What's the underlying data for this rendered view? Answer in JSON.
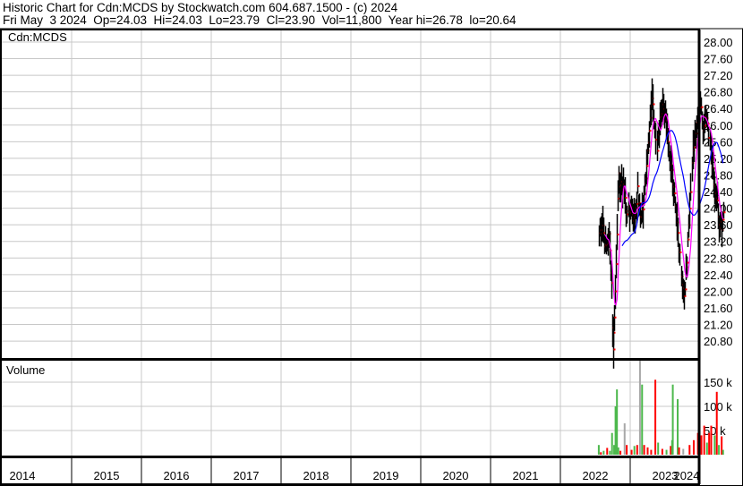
{
  "header": {
    "title": "Historic Chart for Cdn:MCDS by Stockwatch.com 604.687.1500 - (c) 2024",
    "quote": "Fri May  3 2024  Op=24.03  Hi=24.03  Lo=23.79  Cl=23.90  Vol=11,800  Year hi=26.78  lo=20.64"
  },
  "chart_data": {
    "type": "line",
    "symbol_label": "Cdn:MCDS",
    "volume_label": "Volume",
    "price_ticks": [
      "28.00",
      "27.60",
      "27.20",
      "26.80",
      "26.40",
      "26.00",
      "25.60",
      "25.20",
      "24.80",
      "24.40",
      "24.00",
      "23.60",
      "23.20",
      "22.80",
      "22.40",
      "22.00",
      "21.60",
      "21.20",
      "20.80"
    ],
    "ylim": [
      20.5,
      28.3
    ],
    "volume_ticks": [
      {
        "v": 150,
        "label": "150 k"
      },
      {
        "v": 100,
        "label": "100 k"
      },
      {
        "v": 50,
        "label": "50 k"
      }
    ],
    "years": [
      "2014",
      "2015",
      "2016",
      "2017",
      "2018",
      "2019",
      "2020",
      "2021",
      "2022",
      "2023",
      "2024"
    ],
    "xlim": [
      2014.0,
      2024.35
    ],
    "colors": {
      "price": "#000000",
      "close_dot": "#ff0000",
      "ma_short": "#ff00ff",
      "ma_long": "#0000ff",
      "vol_up": "#4cb84c",
      "vol_down": "#ff0000",
      "vol_flat": "#a8a8a8",
      "grid": "#c8c8c8"
    },
    "price_series": [
      [
        2022.55,
        23.4
      ],
      [
        2022.6,
        23.6
      ],
      [
        2022.64,
        23.0
      ],
      [
        2022.69,
        23.3
      ],
      [
        2022.73,
        22.2
      ],
      [
        2022.74,
        21.2
      ],
      [
        2022.76,
        20.7
      ],
      [
        2022.78,
        22.0
      ],
      [
        2022.81,
        23.5
      ],
      [
        2022.83,
        24.7
      ],
      [
        2022.87,
        24.5
      ],
      [
        2022.9,
        24.6
      ],
      [
        2022.94,
        24.0
      ],
      [
        2022.97,
        23.9
      ],
      [
        2023.01,
        24.0
      ],
      [
        2023.05,
        23.7
      ],
      [
        2023.1,
        24.4
      ],
      [
        2023.14,
        23.8
      ],
      [
        2023.18,
        24.0
      ],
      [
        2023.23,
        25.1
      ],
      [
        2023.27,
        26.0
      ],
      [
        2023.31,
        26.6
      ],
      [
        2023.35,
        25.9
      ],
      [
        2023.38,
        25.4
      ],
      [
        2023.42,
        26.2
      ],
      [
        2023.47,
        26.5
      ],
      [
        2023.51,
        26.0
      ],
      [
        2023.55,
        25.2
      ],
      [
        2023.59,
        24.9
      ],
      [
        2023.63,
        24.4
      ],
      [
        2023.67,
        23.6
      ],
      [
        2023.71,
        22.8
      ],
      [
        2023.74,
        22.2
      ],
      [
        2023.77,
        21.9
      ],
      [
        2023.81,
        22.7
      ],
      [
        2023.85,
        24.0
      ],
      [
        2023.88,
        25.0
      ],
      [
        2023.92,
        25.8
      ],
      [
        2023.96,
        26.1
      ],
      [
        2024.0,
        26.5
      ],
      [
        2024.04,
        26.0
      ],
      [
        2024.08,
        26.2
      ],
      [
        2024.12,
        25.8
      ],
      [
        2024.15,
        25.5
      ],
      [
        2024.19,
        24.7
      ],
      [
        2024.23,
        24.3
      ],
      [
        2024.27,
        23.7
      ],
      [
        2024.31,
        23.6
      ],
      [
        2024.33,
        23.9
      ]
    ],
    "volume_series": [
      [
        2022.55,
        20,
        "up"
      ],
      [
        2022.58,
        5,
        "down"
      ],
      [
        2022.62,
        8,
        "up"
      ],
      [
        2022.67,
        14,
        "down"
      ],
      [
        2022.71,
        8,
        "up"
      ],
      [
        2022.74,
        45,
        "up"
      ],
      [
        2022.77,
        20,
        "up"
      ],
      [
        2022.79,
        100,
        "up"
      ],
      [
        2022.81,
        135,
        "up"
      ],
      [
        2022.83,
        15,
        "up"
      ],
      [
        2022.86,
        8,
        "down"
      ],
      [
        2022.92,
        65,
        "flat"
      ],
      [
        2022.95,
        20,
        "down"
      ],
      [
        2023.02,
        10,
        "down"
      ],
      [
        2023.06,
        18,
        "up"
      ],
      [
        2023.1,
        20,
        "down"
      ],
      [
        2023.14,
        200,
        "flat"
      ],
      [
        2023.17,
        145,
        "up"
      ],
      [
        2023.2,
        20,
        "down"
      ],
      [
        2023.25,
        15,
        "down"
      ],
      [
        2023.3,
        10,
        "down"
      ],
      [
        2023.36,
        155,
        "down"
      ],
      [
        2023.4,
        25,
        "up"
      ],
      [
        2023.46,
        12,
        "down"
      ],
      [
        2023.52,
        10,
        "up"
      ],
      [
        2023.58,
        18,
        "down"
      ],
      [
        2023.6,
        30,
        "up"
      ],
      [
        2023.61,
        145,
        "up"
      ],
      [
        2023.68,
        115,
        "up"
      ],
      [
        2023.7,
        15,
        "down"
      ],
      [
        2023.76,
        12,
        "flat"
      ],
      [
        2023.85,
        20,
        "down"
      ],
      [
        2023.91,
        30,
        "down"
      ],
      [
        2023.97,
        45,
        "down"
      ],
      [
        2024.02,
        40,
        "down"
      ],
      [
        2024.06,
        60,
        "down"
      ],
      [
        2024.1,
        25,
        "up"
      ],
      [
        2024.13,
        45,
        "down"
      ],
      [
        2024.16,
        60,
        "down"
      ],
      [
        2024.21,
        40,
        "up"
      ],
      [
        2024.24,
        130,
        "down"
      ],
      [
        2024.27,
        20,
        "up"
      ],
      [
        2024.31,
        38,
        "down"
      ],
      [
        2024.33,
        10,
        "up"
      ]
    ]
  }
}
